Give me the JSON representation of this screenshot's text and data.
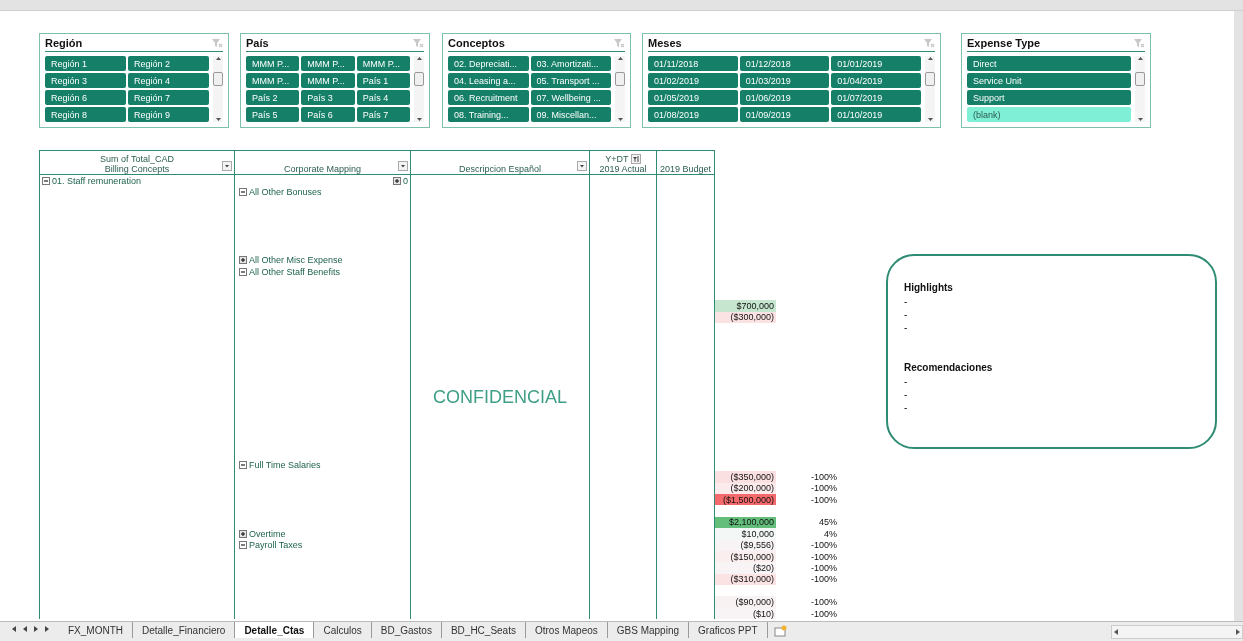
{
  "slicers": [
    {
      "title": "Región",
      "items": [
        {
          "label": "Región 1",
          "selected": true
        },
        {
          "label": "Región 2",
          "selected": true
        },
        {
          "label": "Región 3",
          "selected": true
        },
        {
          "label": "Región 4",
          "selected": true
        },
        {
          "label": "Región 6",
          "selected": true
        },
        {
          "label": "Región 7",
          "selected": true
        },
        {
          "label": "Región 8",
          "selected": true
        },
        {
          "label": "Región 9",
          "selected": true
        }
      ]
    },
    {
      "title": "País",
      "items": [
        {
          "label": "MMM P...",
          "selected": true
        },
        {
          "label": "MMM P...",
          "selected": true
        },
        {
          "label": "MMM P...",
          "selected": true
        },
        {
          "label": "MMM P...",
          "selected": true
        },
        {
          "label": "MMM P...",
          "selected": true
        },
        {
          "label": "País 1",
          "selected": true
        },
        {
          "label": "País 2",
          "selected": true
        },
        {
          "label": "País 3",
          "selected": true
        },
        {
          "label": "País 4",
          "selected": true
        },
        {
          "label": "País 5",
          "selected": true
        },
        {
          "label": "País 6",
          "selected": true
        },
        {
          "label": "País 7",
          "selected": true
        }
      ]
    },
    {
      "title": "Conceptos",
      "items": [
        {
          "label": "02. Depreciati...",
          "selected": true
        },
        {
          "label": "03. Amortizati...",
          "selected": true
        },
        {
          "label": "04. Leasing a...",
          "selected": true
        },
        {
          "label": "05. Transport ...",
          "selected": true
        },
        {
          "label": "06. Recruitment",
          "selected": true
        },
        {
          "label": "07. Wellbeing ...",
          "selected": true
        },
        {
          "label": "08. Training...",
          "selected": true
        },
        {
          "label": "09. Miscellan...",
          "selected": true
        }
      ]
    },
    {
      "title": "Meses",
      "items": [
        {
          "label": "01/11/2018",
          "selected": true
        },
        {
          "label": "01/12/2018",
          "selected": true
        },
        {
          "label": "01/01/2019",
          "selected": true
        },
        {
          "label": "01/02/2019",
          "selected": true
        },
        {
          "label": "01/03/2019",
          "selected": true
        },
        {
          "label": "01/04/2019",
          "selected": true
        },
        {
          "label": "01/05/2019",
          "selected": true
        },
        {
          "label": "01/06/2019",
          "selected": true
        },
        {
          "label": "01/07/2019",
          "selected": true
        },
        {
          "label": "01/08/2019",
          "selected": true
        },
        {
          "label": "01/09/2019",
          "selected": true
        },
        {
          "label": "01/10/2019",
          "selected": true
        }
      ]
    },
    {
      "title": "Expense Type",
      "items": [
        {
          "label": "Direct",
          "selected": true
        },
        {
          "label": "Service Unit",
          "selected": true
        },
        {
          "label": "Support",
          "selected": true
        },
        {
          "label": "(blank)",
          "selected": false
        }
      ]
    }
  ],
  "pivot": {
    "values_label": "Sum of Total_CAD",
    "filter_label": "Y+DT",
    "columns": [
      "Billing Concepts",
      "Corporate Mapping",
      "Descripcion Español",
      "2019 Actual",
      "2019 Budget"
    ],
    "rows": [
      {
        "concept": {
          "label": "01. Staff remuneration",
          "expanded": true
        },
        "mapping_total": {
          "label": "0",
          "expanded": false
        }
      },
      {
        "mapping": {
          "label": "All Other Bonuses",
          "expanded": true
        }
      },
      {},
      {},
      {},
      {},
      {},
      {
        "mapping": {
          "label": "All Other Misc Expense",
          "expanded": false
        }
      },
      {
        "mapping": {
          "label": "All Other Staff Benefits",
          "expanded": true
        }
      },
      {},
      {},
      {
        "variance": {
          "text": "$700,000",
          "color": "#c6e6cf"
        }
      },
      {
        "variance": {
          "text": "($300,000)",
          "color": "#fbe3e3"
        }
      },
      {},
      {},
      {},
      {},
      {},
      {},
      {
        "description": "CONFIDENCIAL"
      },
      {},
      {},
      {},
      {},
      {},
      {
        "mapping": {
          "label": "Full Time Salaries",
          "expanded": true
        }
      },
      {
        "variance": {
          "text": "($350,000)",
          "color": "#fbe0e1"
        },
        "percent": "-100%"
      },
      {
        "variance": {
          "text": "($200,000)",
          "color": "#fcebec"
        },
        "percent": "-100%"
      },
      {
        "variance": {
          "text": "($1,500,000)",
          "color": "#f4696b"
        },
        "percent": "-100%"
      },
      {},
      {
        "variance": {
          "text": "$2,100,000",
          "color": "#63be7b"
        },
        "percent": "45%"
      },
      {
        "mapping": {
          "label": "Overtime",
          "expanded": false
        },
        "variance": {
          "text": "$10,000",
          "color": "#f3f8f6"
        },
        "percent": "4%"
      },
      {
        "mapping": {
          "label": "Payroll Taxes",
          "expanded": true
        },
        "variance": {
          "text": "($9,556)",
          "color": "#f8f4f5"
        },
        "percent": "-100%"
      },
      {
        "variance": {
          "text": "($150,000)",
          "color": "#fbeeef"
        },
        "percent": "-100%"
      },
      {
        "variance": {
          "text": "($20)",
          "color": "#f8f4f5"
        },
        "percent": "-100%"
      },
      {
        "variance": {
          "text": "($310,000)",
          "color": "#fbe3e4"
        },
        "percent": "-100%"
      },
      {},
      {
        "variance": {
          "text": "($90,000)",
          "color": "#f9f2f3"
        },
        "percent": "-100%"
      },
      {
        "variance": {
          "text": "($10)",
          "color": "#f8f4f5"
        },
        "percent": "-100%"
      }
    ]
  },
  "notes": {
    "sections": [
      {
        "title": "Highlights",
        "lines": [
          "-",
          "-",
          "-"
        ]
      },
      {
        "title": "Recomendaciones",
        "lines": [
          "-",
          "-",
          "-"
        ]
      }
    ]
  },
  "sheet_tabs": [
    {
      "label": "FX_MONTH",
      "selected": false
    },
    {
      "label": "Detalle_Financiero",
      "selected": false
    },
    {
      "label": "Detalle_Ctas",
      "selected": true
    },
    {
      "label": "Calculos",
      "selected": false
    },
    {
      "label": "BD_Gastos",
      "selected": false
    },
    {
      "label": "BD_HC_Seats",
      "selected": false
    },
    {
      "label": "Otros Mapeos",
      "selected": false
    },
    {
      "label": "GBS Mapping",
      "selected": false
    },
    {
      "label": "Graficos PPT",
      "selected": false
    }
  ]
}
